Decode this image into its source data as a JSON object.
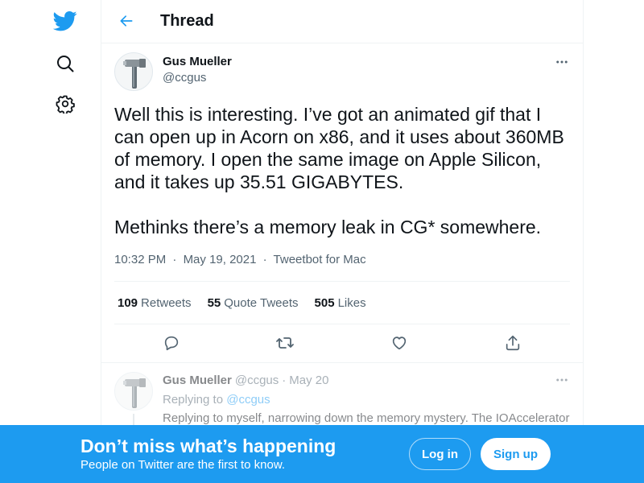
{
  "colors": {
    "brand": "#1d9bf0",
    "text": "#0f1419",
    "secondary": "#536471",
    "border": "#eff3f4"
  },
  "sidebar": {
    "items": [
      {
        "icon": "twitter-logo-icon"
      },
      {
        "icon": "search-icon"
      },
      {
        "icon": "gear-icon"
      }
    ]
  },
  "header": {
    "back_icon": "arrow-left-icon",
    "title": "Thread"
  },
  "tweet": {
    "author_name": "Gus Mueller",
    "author_handle": "@ccgus",
    "more_icon": "more-dots-icon",
    "text_paragraphs": [
      "Well this is interesting. I’ve got an animated gif that I can open up in Acorn on x86, and it uses about 360MB of memory. I open the same image on Apple Silicon, and it takes up 35.51 GIGABYTES.",
      "Methinks there’s a memory leak in CG* somewhere."
    ],
    "time": "10:32 PM",
    "date": "May 19, 2021",
    "separator": "·",
    "source": "Tweetbot for Mac",
    "stats": {
      "retweets_count": "109",
      "retweets_label": "Retweets",
      "quote_count": "55",
      "quote_label": "Quote Tweets",
      "likes_count": "505",
      "likes_label": "Likes"
    },
    "actions": [
      {
        "icon": "reply-icon"
      },
      {
        "icon": "retweet-icon"
      },
      {
        "icon": "like-heart-icon"
      },
      {
        "icon": "share-icon"
      }
    ]
  },
  "reply": {
    "author_name": "Gus Mueller",
    "author_handle": "@ccgus",
    "separator": "·",
    "date": "May 20",
    "replying_label": "Replying to",
    "replying_mention": "@ccgus",
    "text": "Replying to myself, narrowing down the memory mystery. The IOAccelerator"
  },
  "banner": {
    "title": "Don’t miss what’s happening",
    "subtitle": "People on Twitter are the first to know.",
    "login_label": "Log in",
    "signup_label": "Sign up"
  }
}
